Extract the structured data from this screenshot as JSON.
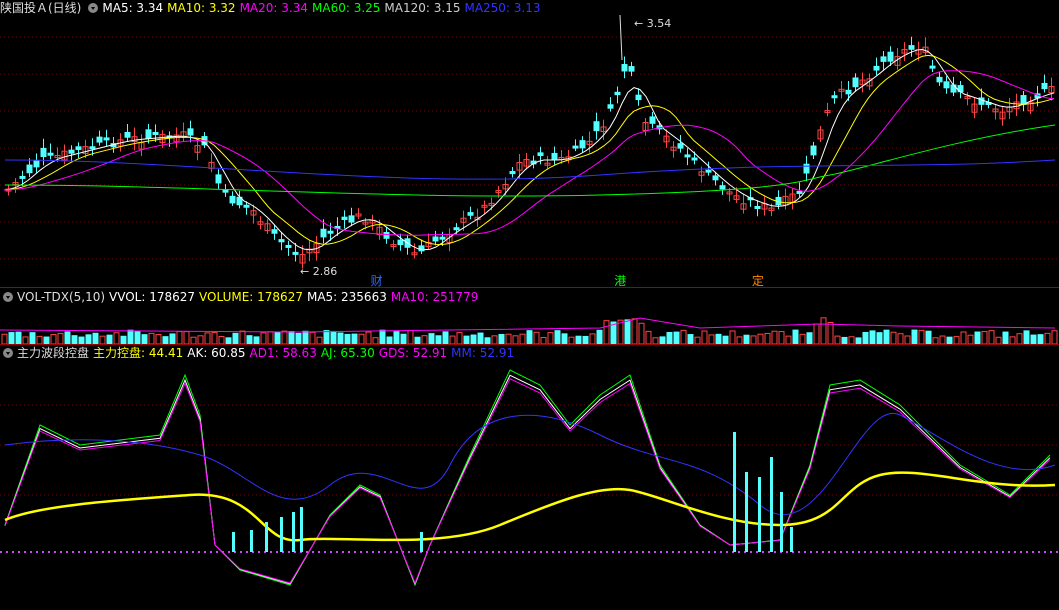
{
  "main": {
    "title": "陕国投Ａ(日线)",
    "items": [
      {
        "label": "MA5: 3.34",
        "color": "#ffffff"
      },
      {
        "label": "MA10: 3.32",
        "color": "#ffff00"
      },
      {
        "label": "MA20: 3.34",
        "color": "#ff00ff"
      },
      {
        "label": "MA60: 3.25",
        "color": "#00ff00"
      },
      {
        "label": "MA120: 3.15",
        "color": "#cccccc"
      },
      {
        "label": "MA250: 3.13",
        "color": "#3333ff"
      }
    ],
    "high_label": "3.54",
    "low_label": "2.86",
    "markers": [
      {
        "text": "财",
        "color": "#3366ff",
        "x_index": 0.35
      },
      {
        "text": "港",
        "color": "#00ff00",
        "x_index": 0.58
      },
      {
        "text": "定",
        "color": "#ff8800",
        "x_index": 0.71
      }
    ]
  },
  "vol": {
    "title": "VOL-TDX(5,10)",
    "items": [
      {
        "label": "VVOL: 178627",
        "color": "#ffffff"
      },
      {
        "label": "VOLUME: 178627",
        "color": "#ffff00"
      },
      {
        "label": "MA5: 235663",
        "color": "#ffffff"
      },
      {
        "label": "MA10: 251779",
        "color": "#ff00ff"
      }
    ]
  },
  "ind": {
    "title": "主力波段控盘",
    "items": [
      {
        "label": "主力控盘: 44.41",
        "color": "#ffff00"
      },
      {
        "label": "AK: 60.85",
        "color": "#ffffff"
      },
      {
        "label": "AD1: 58.63",
        "color": "#ff00ff"
      },
      {
        "label": "AJ: 65.30",
        "color": "#00ff00"
      },
      {
        "label": "GDS: 52.91",
        "color": "#ff00ff"
      },
      {
        "label": "MM: 52.91",
        "color": "#3333ff"
      }
    ]
  },
  "icons": {
    "menu": "circle-dropdown-icon"
  }
}
